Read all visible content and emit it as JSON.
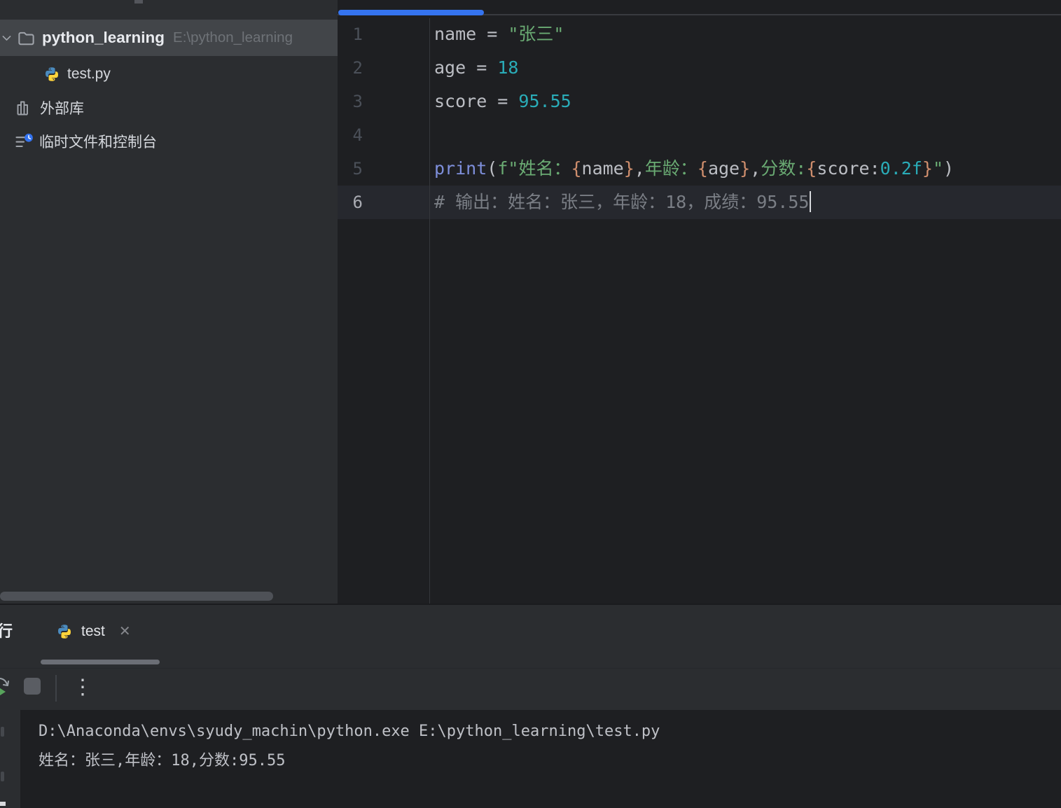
{
  "colors": {
    "accent_blue": "#3574F0",
    "editor_bg": "#1E1F22",
    "panel_bg": "#2B2D30",
    "selection_bg": "#424549",
    "string_green": "#6AAB73",
    "number_teal": "#2AACB8",
    "builtin_blue": "#7E8FDB",
    "brace_orange": "#CF8E6D",
    "comment_grey": "#7A7E85",
    "python_icon_blue": "#4B8BBE",
    "python_icon_yellow": "#FFD43B"
  },
  "icons": {
    "close": "✕",
    "more": "⋮"
  },
  "project_panel": {
    "root_name": "python_learning",
    "root_path": "E:\\python_learning",
    "items": [
      {
        "label": "test.py",
        "icon": "python-icon"
      },
      {
        "label": "外部库",
        "icon": "library-icon"
      },
      {
        "label": "临时文件和控制台",
        "icon": "scratches-icon"
      }
    ]
  },
  "editor": {
    "lines": [
      {
        "num": "1",
        "tokens": [
          {
            "t": "name = ",
            "c": "plain"
          },
          {
            "t": "\"张三\"",
            "c": "str"
          }
        ]
      },
      {
        "num": "2",
        "tokens": [
          {
            "t": "age = ",
            "c": "plain"
          },
          {
            "t": "18",
            "c": "num"
          }
        ]
      },
      {
        "num": "3",
        "tokens": [
          {
            "t": "score = ",
            "c": "plain"
          },
          {
            "t": "95.55",
            "c": "num"
          }
        ]
      },
      {
        "num": "4",
        "tokens": []
      },
      {
        "num": "5",
        "tokens": [
          {
            "t": "print",
            "c": "kw"
          },
          {
            "t": "(",
            "c": "plain"
          },
          {
            "t": "f",
            "c": "str"
          },
          {
            "t": "\"姓名：",
            "c": "str"
          },
          {
            "t": "{",
            "c": "brace"
          },
          {
            "t": "name",
            "c": "plain"
          },
          {
            "t": "}",
            "c": "brace"
          },
          {
            "t": ",",
            "c": "plain"
          },
          {
            "t": "年龄：",
            "c": "str"
          },
          {
            "t": "{",
            "c": "brace"
          },
          {
            "t": "age",
            "c": "plain"
          },
          {
            "t": "}",
            "c": "brace"
          },
          {
            "t": ",",
            "c": "plain"
          },
          {
            "t": "分数:",
            "c": "str"
          },
          {
            "t": "{",
            "c": "brace"
          },
          {
            "t": "score",
            "c": "plain"
          },
          {
            "t": ":",
            "c": "plain"
          },
          {
            "t": "0.2f",
            "c": "num"
          },
          {
            "t": "}",
            "c": "brace"
          },
          {
            "t": "\"",
            "c": "str"
          },
          {
            "t": ")",
            "c": "plain"
          }
        ]
      },
      {
        "num": "6",
        "active": true,
        "caret": true,
        "tokens": [
          {
            "t": "# 输出：姓名：张三，年龄：18，成绩：95.55",
            "c": "comment"
          }
        ]
      }
    ]
  },
  "run_panel": {
    "window_title": "运行",
    "tab_label": "test"
  },
  "console": {
    "lines": [
      "D:\\Anaconda\\envs\\syudy_machin\\python.exe E:\\python_learning\\test.py",
      "姓名：张三,年龄：18,分数:95.55"
    ]
  }
}
